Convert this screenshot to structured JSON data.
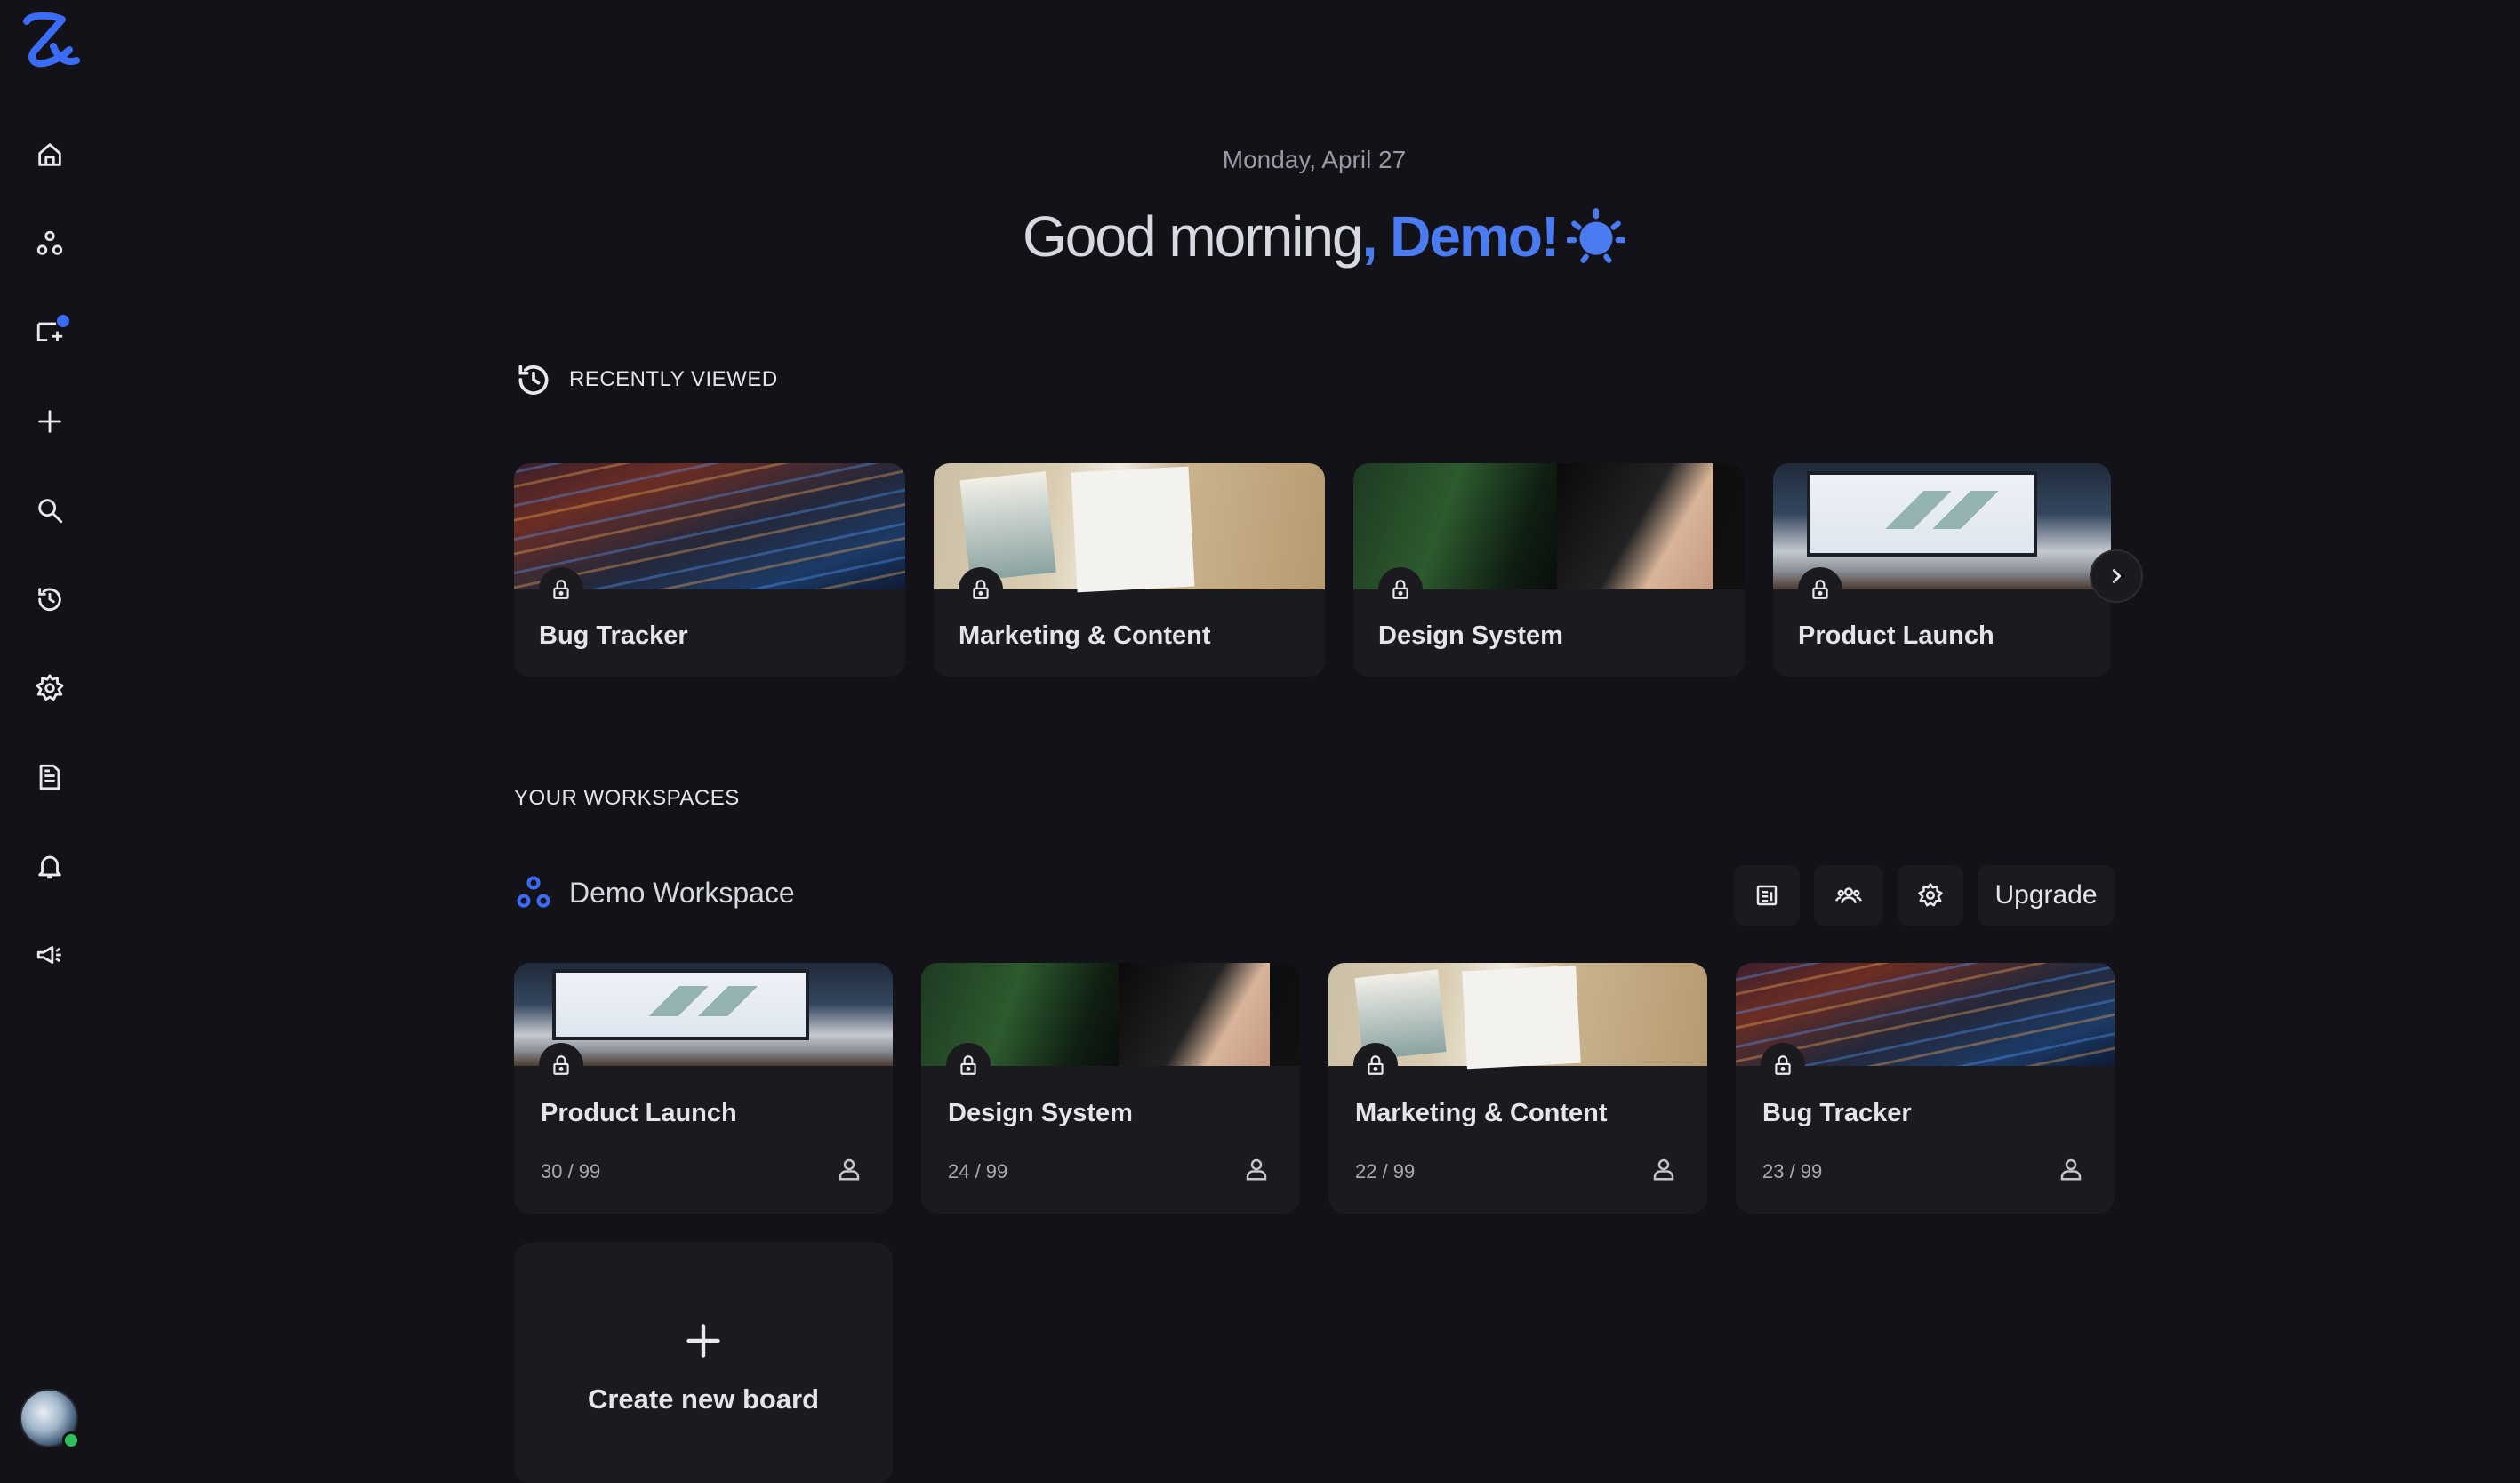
{
  "sidebar": {
    "items": [
      {
        "icon": "home-icon"
      },
      {
        "icon": "workspaces-icon"
      },
      {
        "icon": "messages-icon"
      },
      {
        "icon": "add-icon"
      },
      {
        "icon": "search-icon"
      },
      {
        "icon": "history-icon"
      },
      {
        "icon": "settings-icon"
      },
      {
        "icon": "document-icon"
      },
      {
        "icon": "bell-icon"
      },
      {
        "icon": "megaphone-icon"
      }
    ]
  },
  "header": {
    "date": "Monday, April 27",
    "greeting": "Good morning",
    "name": ", Demo!"
  },
  "recently_viewed": {
    "title": "RECENTLY VIEWED",
    "cards": [
      {
        "title": "Bug Tracker"
      },
      {
        "title": "Marketing & Content"
      },
      {
        "title": "Design System"
      },
      {
        "title": "Product Launch"
      }
    ]
  },
  "workspaces": {
    "title": "YOUR WORKSPACES",
    "workspace": {
      "name": "Demo Workspace",
      "upgrade_label": "Upgrade",
      "boards": [
        {
          "title": "Product Launch",
          "count": "30 / 99"
        },
        {
          "title": "Design System",
          "count": "24 / 99"
        },
        {
          "title": "Marketing & Content",
          "count": "22 / 99"
        },
        {
          "title": "Bug Tracker",
          "count": "23 / 99"
        }
      ],
      "create_label": "Create new board"
    }
  },
  "colors": {
    "accent": "#3b6cf6",
    "background": "#121218",
    "card": "#1b1b1f",
    "online": "#2fbf5a"
  }
}
